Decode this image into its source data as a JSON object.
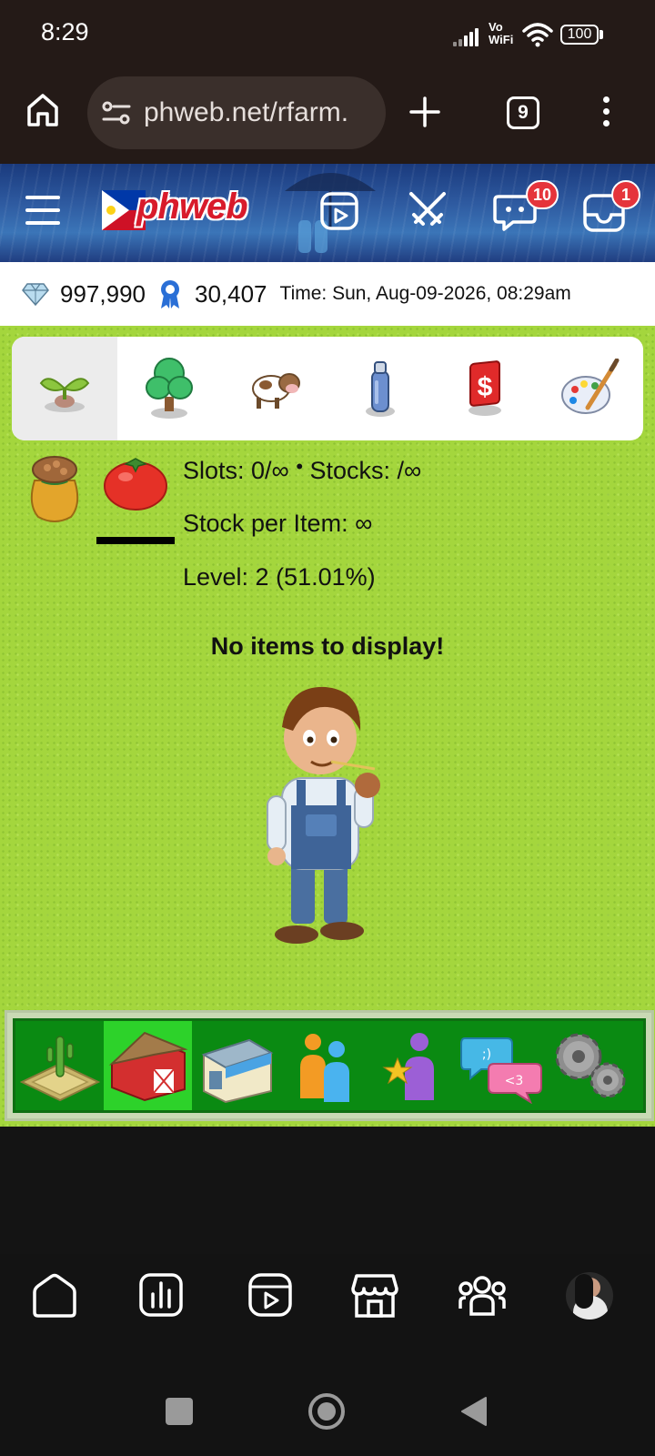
{
  "status_bar": {
    "time": "8:29",
    "vowifi": "Vo\nWiFi",
    "battery": "100"
  },
  "browser": {
    "url": "phweb.net/rfarm.",
    "tab_count": "9"
  },
  "site_header": {
    "logo_text": "phweb",
    "chat_badge": "10",
    "inbox_badge": "1"
  },
  "stats": {
    "diamonds": "997,990",
    "medals": "30,407",
    "time": "Time: Sun, Aug-09-2026, 08:29am"
  },
  "category_tabs": [
    {
      "icon": "seedling-icon",
      "active": true
    },
    {
      "icon": "tree-icon",
      "active": false
    },
    {
      "icon": "cow-icon",
      "active": false
    },
    {
      "icon": "spray-can-icon",
      "active": false
    },
    {
      "icon": "dollar-sign-icon",
      "active": false
    },
    {
      "icon": "paint-palette-icon",
      "active": false
    }
  ],
  "farm_info": {
    "slots": "Slots: 0/∞",
    "stocks": "Stocks: /∞",
    "stock_per_item": "Stock per Item: ∞",
    "level": "Level: 2 (51.01%)",
    "empty_message": "No items to display!"
  },
  "game_nav": [
    {
      "icon": "farm-plot-icon",
      "active": false
    },
    {
      "icon": "barn-icon",
      "active": true
    },
    {
      "icon": "shop-icon",
      "active": false
    },
    {
      "icon": "friends-icon",
      "active": false
    },
    {
      "icon": "star-user-icon",
      "active": false
    },
    {
      "icon": "chat-bubbles-icon",
      "active": false
    },
    {
      "icon": "settings-gears-icon",
      "active": false
    }
  ],
  "colors": {
    "grass": "#a4d63d",
    "nav_green": "#0a8a12",
    "nav_active": "#2dd22a",
    "badge_red": "#e5343b"
  }
}
